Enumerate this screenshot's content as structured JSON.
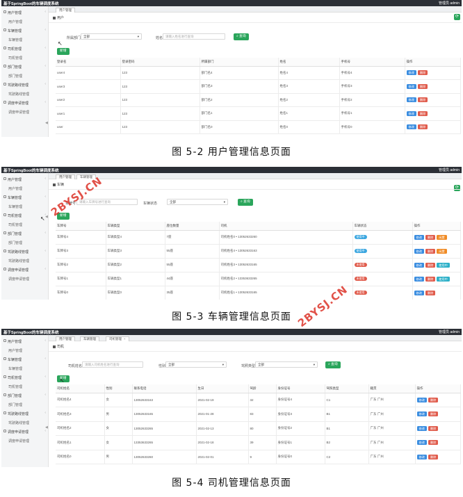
{
  "screens": [
    {
      "app_title": "基于SpringBoot的车辆调度系统",
      "user": "管理员 admin",
      "sidebar": [
        {
          "label": "用户管理",
          "type": "group"
        },
        {
          "label": "用户管理",
          "type": "sub"
        },
        {
          "label": "车辆管理",
          "type": "group"
        },
        {
          "label": "车辆管理",
          "type": "sub"
        },
        {
          "label": "司机管理",
          "type": "group"
        },
        {
          "label": "司机管理",
          "type": "sub"
        },
        {
          "label": "部门管理",
          "type": "group"
        },
        {
          "label": "部门管理",
          "type": "sub"
        },
        {
          "label": "驾驶路线管理",
          "type": "group"
        },
        {
          "label": "驾驶路线管理",
          "type": "sub"
        },
        {
          "label": "调度申请管理",
          "type": "group"
        },
        {
          "label": "调度申请管理",
          "type": "sub"
        }
      ],
      "tabs": [
        "用户管理"
      ],
      "breadcrumb": "用户",
      "filters": {
        "dept_label": "所属部门",
        "dept_value": "全部",
        "name_label": "姓名",
        "name_placeholder": "请输入姓名进行查询",
        "query_label": "查询"
      },
      "add_label": "新增",
      "table": {
        "headers": [
          "登录名",
          "登录密码",
          "所属部门",
          "姓名",
          "手机号",
          "操作"
        ],
        "rows": [
          [
            "user4",
            "123",
            "部门名4",
            "姓名4",
            "手机号4"
          ],
          [
            "user3",
            "123",
            "部门名3",
            "姓名3",
            "手机号3"
          ],
          [
            "user2",
            "123",
            "部门名2",
            "姓名2",
            "手机号2"
          ],
          [
            "user1",
            "123",
            "部门名1",
            "姓名1",
            "手机号1"
          ],
          [
            "user",
            "123",
            "部门名0",
            "姓名0",
            "手机号0"
          ]
        ]
      },
      "actions": {
        "edit": "修改",
        "delete": "删除"
      },
      "caption": "图 5-2 用户管理信息页面"
    },
    {
      "app_title": "基于SpringBoot的车辆调度系统",
      "user": "管理员 admin",
      "sidebar": [
        {
          "label": "用户管理",
          "type": "group"
        },
        {
          "label": "用户管理",
          "type": "sub"
        },
        {
          "label": "车辆管理",
          "type": "group"
        },
        {
          "label": "车辆管理",
          "type": "sub"
        },
        {
          "label": "司机管理",
          "type": "group"
        },
        {
          "label": "司机管理",
          "type": "sub"
        },
        {
          "label": "部门管理",
          "type": "group"
        },
        {
          "label": "部门管理",
          "type": "sub"
        },
        {
          "label": "驾驶路线管理",
          "type": "group"
        },
        {
          "label": "驾驶路线管理",
          "type": "sub"
        },
        {
          "label": "调度申请管理",
          "type": "group"
        },
        {
          "label": "调度申请管理",
          "type": "sub"
        }
      ],
      "tabs": [
        "用户管理",
        "车辆管理"
      ],
      "breadcrumb": "车辆",
      "filters": {
        "plate_label": "车牌号",
        "plate_placeholder": "请输入车牌号进行查询",
        "status_label": "车辆状态",
        "status_value": "全部",
        "query_label": "查询"
      },
      "add_label": "新增",
      "table": {
        "headers": [
          "车牌号",
          "车辆类型",
          "座位数量",
          "司机",
          "车辆状态",
          "操作"
        ],
        "rows": [
          [
            "车牌号4",
            "车辆类型4",
            "7座",
            "司机姓名0 • 13052633260",
            "使用中"
          ],
          [
            "车牌号3",
            "车辆类型3",
            "55座",
            "司机姓名4 • 13052633163",
            "使用中"
          ],
          [
            "车牌号2",
            "车辆类型2",
            "55座",
            "司机姓名3 • 13052633165",
            "未使用"
          ],
          [
            "车牌号1",
            "车辆类型1",
            "44座",
            "司机姓名2 • 13353633265",
            "未使用"
          ],
          [
            "车牌号0",
            "车辆类型0",
            "35座",
            "司机姓名1 • 13052633165",
            "未使用"
          ]
        ],
        "extra_actions": [
          "闲置",
          "闲置",
          "使用中",
          "使用中",
          ""
        ]
      },
      "actions": {
        "edit": "修改",
        "delete": "删除"
      },
      "caption": "图 5-3 车辆管理信息页面"
    },
    {
      "app_title": "基于SpringBoot的车辆调度系统",
      "user": "管理员 admin",
      "sidebar": [
        {
          "label": "用户管理",
          "type": "group"
        },
        {
          "label": "用户管理",
          "type": "sub"
        },
        {
          "label": "车辆管理",
          "type": "group"
        },
        {
          "label": "车辆管理",
          "type": "sub"
        },
        {
          "label": "司机管理",
          "type": "group"
        },
        {
          "label": "司机管理",
          "type": "sub"
        },
        {
          "label": "部门管理",
          "type": "group"
        },
        {
          "label": "部门管理",
          "type": "sub"
        },
        {
          "label": "驾驶路线管理",
          "type": "group"
        },
        {
          "label": "驾驶路线管理",
          "type": "sub"
        },
        {
          "label": "调度申请管理",
          "type": "group"
        },
        {
          "label": "调度申请管理",
          "type": "sub"
        }
      ],
      "tabs": [
        "用户管理",
        "车辆管理",
        "司机管理"
      ],
      "breadcrumb": "司机",
      "filters": {
        "name_label": "司机姓名",
        "name_placeholder": "请输入司机姓名进行查询",
        "gender_label": "性别",
        "gender_value": "全部",
        "license_label": "驾照类型",
        "license_value": "全部",
        "query_label": "查询"
      },
      "add_label": "新增",
      "table": {
        "headers": [
          "司机姓名",
          "性别",
          "联系电话",
          "生日",
          "驾龄",
          "身份证号",
          "驾照类型",
          "籍贯",
          "操作"
        ],
        "rows": [
          [
            "司机姓名4",
            "女",
            "13052633163",
            "2021-02-19",
            "32",
            "身份证号4",
            "C1",
            "广东 广州"
          ],
          [
            "司机姓名3",
            "男",
            "13052633165",
            "2021-01-28",
            "83",
            "身份证号3",
            "B1",
            "广东 广州"
          ],
          [
            "司机姓名2",
            "女",
            "13052633265",
            "2021-02-13",
            "80",
            "身份证号2",
            "B1",
            "广东 广州"
          ],
          [
            "司机姓名1",
            "女",
            "13353633265",
            "2021-02-18",
            "39",
            "身份证号1",
            "B2",
            "广东 广州"
          ],
          [
            "司机姓名0",
            "男",
            "13052633260",
            "2021-02-01",
            "9",
            "身份证号0",
            "C2",
            "广东 广州"
          ]
        ]
      },
      "actions": {
        "edit": "修改",
        "delete": "删除"
      },
      "caption": "图 5-4 司机管理信息页面"
    }
  ],
  "watermarks": [
    "2BYSJ.CN",
    "2BYSJ.CN"
  ]
}
